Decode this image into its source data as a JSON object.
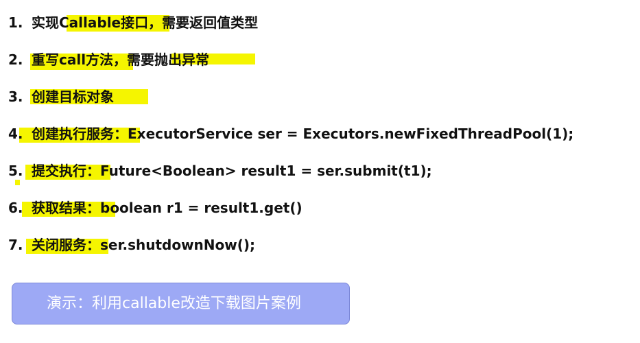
{
  "steps": [
    {
      "num": "1.",
      "label": "实现Callable接口，",
      "rest": "需要返回值类型"
    },
    {
      "num": "2.",
      "label": "重写call方法，需要抛出异常",
      "rest": ""
    },
    {
      "num": "3.",
      "label": "创建目标对象",
      "rest": ""
    },
    {
      "num": "4.",
      "label": "创建执行服务：",
      "rest": "ExecutorService ser = Executors.newFixedThreadPool(1);"
    },
    {
      "num": "5.",
      "label": "提交执行：",
      "rest": "Future<Boolean> result1 = ser.submit(t1);"
    },
    {
      "num": "6.",
      "label": "获取结果：",
      "rest": "boolean r1 = result1.get()"
    },
    {
      "num": "7.",
      "label": "关闭服务：",
      "rest": "ser.shutdownNow();"
    }
  ],
  "demo_button": {
    "label": "演示：利用callable改造下载图片案例"
  },
  "colors": {
    "highlight": "#f5f500",
    "button_bg": "#9da9f5",
    "button_text": "#ffffff"
  }
}
